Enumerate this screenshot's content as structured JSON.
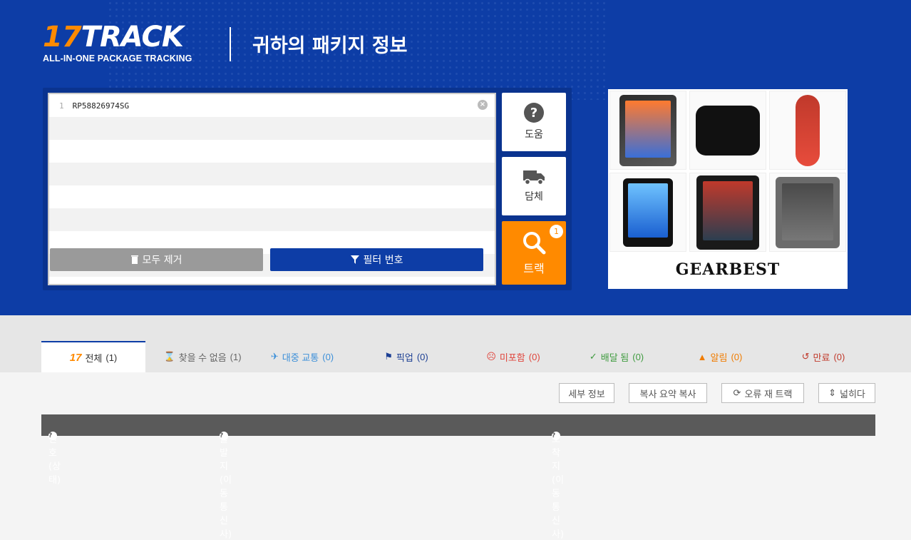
{
  "header": {
    "logo_mark_num": "17",
    "logo_mark_text": "TRACK",
    "logo_tagline": "ALL-IN-ONE PACKAGE TRACKING",
    "title": "귀하의 패키지 정보"
  },
  "input": {
    "line_number": "1",
    "tracking_number": "RP58826974SG",
    "clear_all_label": "모두 제거",
    "filter_label": "필터 번호"
  },
  "side_buttons": {
    "help_label": "도움",
    "carrier_label": "담체",
    "track_label": "트랙",
    "track_badge": "1"
  },
  "ad": {
    "brand": "GEARBEST",
    "icons": [
      "info-icon",
      "close-icon"
    ]
  },
  "tabs": [
    {
      "label": "전체",
      "count": "(1)",
      "color": "#333333",
      "icon": "logo-17-icon"
    },
    {
      "label": "찾을 수 없음",
      "count": "(1)",
      "color": "#666666",
      "icon": "hourglass-icon"
    },
    {
      "label": "대중 교통",
      "count": "(0)",
      "color": "#3b8fd9",
      "icon": "plane-icon"
    },
    {
      "label": "픽업",
      "count": "(0)",
      "color": "#1c3f94",
      "icon": "flag-icon"
    },
    {
      "label": "미포함",
      "count": "(0)",
      "color": "#e0443b",
      "icon": "sad-face-icon"
    },
    {
      "label": "배달 됨",
      "count": "(0)",
      "color": "#3f9b3f",
      "icon": "check-icon"
    },
    {
      "label": "알림",
      "count": "(0)",
      "color": "#f07c00",
      "icon": "warning-icon"
    },
    {
      "label": "만료",
      "count": "(0)",
      "color": "#c0392b",
      "icon": "history-icon"
    }
  ],
  "toolbar": {
    "details_label": "세부 정보",
    "copy_summary_label": "복사 요약 복사",
    "retrack_label": "오류 재 트랙",
    "expand_label": "넓히다"
  },
  "table": {
    "col_number": "번호 (상태)",
    "col_origin": "출발지 (이동 통신사)",
    "col_destination": "도착지 (이동 통신사)"
  }
}
